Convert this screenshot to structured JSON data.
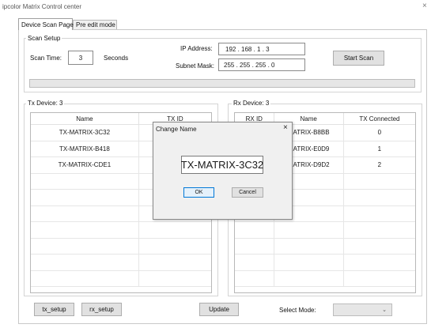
{
  "window": {
    "title": "ipcolor Matrix Control center",
    "close_glyph": "×"
  },
  "tabs": [
    {
      "label": "Device Scan Page",
      "active": true
    },
    {
      "label": "Pre edit mode",
      "active": false
    }
  ],
  "scan_setup": {
    "title": "Scan Setup",
    "scan_time_label": "Scan Time:",
    "scan_time_value": "3",
    "seconds_label": "Seconds",
    "ip_label": "IP Address:",
    "ip_value": "192  .  168  .   1   .   3",
    "subnet_label": "Subnet Mask:",
    "subnet_value": "255  .  255  .  255  .   0",
    "start_button": "Start Scan",
    "progress_fraction": 0
  },
  "tx": {
    "title": "Tx Device: 3",
    "columns": [
      "Name",
      "TX ID"
    ],
    "rows": [
      [
        "TX-MATRIX-3C32",
        ""
      ],
      [
        "TX-MATRIX-B418",
        ""
      ],
      [
        "TX-MATRIX-CDE1",
        ""
      ]
    ]
  },
  "rx": {
    "title": "Rx Device: 3",
    "columns": [
      "RX ID",
      "Name",
      "TX Connected"
    ],
    "rows": [
      [
        "",
        "MATRIX-B8BB",
        "0"
      ],
      [
        "",
        "MATRIX-E0D9",
        "1"
      ],
      [
        "",
        "MATRIX-D9D2",
        "2"
      ]
    ]
  },
  "dialog": {
    "title": "Change Name",
    "close_glyph": "×",
    "value": "TX-MATRIX-3C32",
    "ok": "OK",
    "cancel": "Cancel"
  },
  "bottom": {
    "tx_setup": "tx_setup",
    "rx_setup": "rx_setup",
    "update": "Update",
    "select_mode_label": "Select Mode:",
    "select_mode_value": "",
    "dropdown_glyph": "⌄"
  },
  "icons": {
    "close": "close-icon",
    "dropdown": "chevron-down-icon"
  }
}
